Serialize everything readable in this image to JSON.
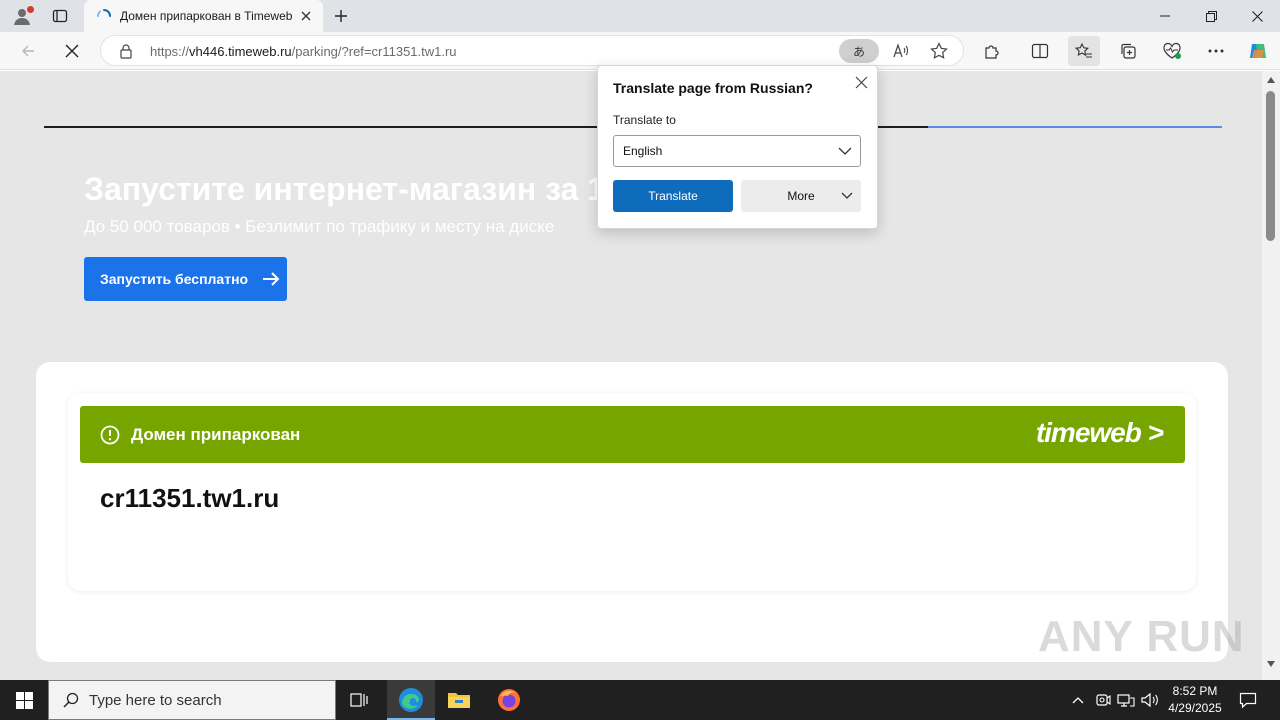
{
  "browser": {
    "tab_title": "Домен припаркован в Timeweb",
    "url_prefix": "https://",
    "url_host": "vh446.timeweb.ru",
    "url_path": "/parking/?ref=cr11351.tw1.ru",
    "translate_pill": "あ"
  },
  "page": {
    "hero_title": "Запустите интернет-магазин за 1",
    "hero_subtitle": "До 50 000 товаров • Безлимит по трафику и месту на диске",
    "hero_button": "Запустить бесплатно",
    "banner_text": "Домен припаркован",
    "logo_text": "timeweb >",
    "domain": "cr11351.tw1.ru"
  },
  "translate_popup": {
    "title": "Translate page from Russian?",
    "label": "Translate to",
    "selected_language": "English",
    "translate_button": "Translate",
    "more_button": "More"
  },
  "watermark": "ANY RUN",
  "taskbar": {
    "search_placeholder": "Type here to search",
    "time": "8:52 PM",
    "date": "4/29/2025"
  },
  "colors": {
    "banner_green": "#77a500",
    "hero_button_blue": "#1a73e8",
    "translate_button_blue": "#0f6cbd",
    "page_background": "#e6e6e6"
  }
}
